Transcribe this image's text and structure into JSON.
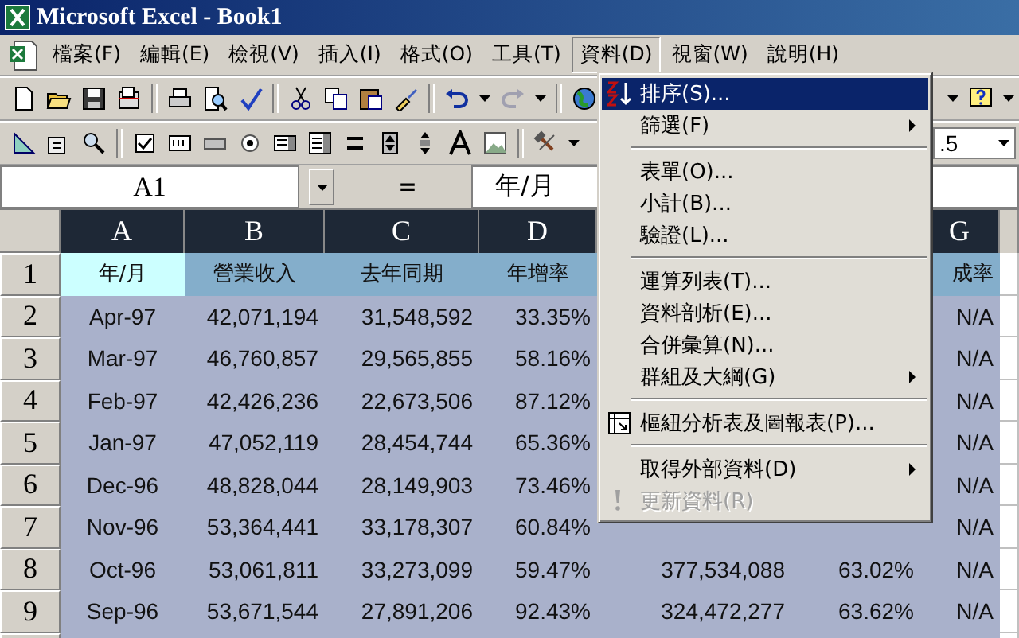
{
  "window": {
    "title": "Microsoft Excel - Book1"
  },
  "menu_bar": [
    {
      "label": "檔案(F)",
      "selected": false
    },
    {
      "label": "編輯(E)",
      "selected": false
    },
    {
      "label": "檢視(V)",
      "selected": false
    },
    {
      "label": "插入(I)",
      "selected": false
    },
    {
      "label": "格式(O)",
      "selected": false
    },
    {
      "label": "工具(T)",
      "selected": false
    },
    {
      "label": "資料(D)",
      "selected": true
    },
    {
      "label": "視窗(W)",
      "selected": false
    },
    {
      "label": "說明(H)",
      "selected": false
    }
  ],
  "toolbar_field": {
    "value": ".5"
  },
  "formula_bar": {
    "name_box": "A1",
    "equals": "=",
    "content": "年/月"
  },
  "sheet": {
    "left_columns": [
      {
        "label": "A",
        "selected": true
      },
      {
        "label": "B",
        "selected": true
      },
      {
        "label": "C",
        "selected": true
      },
      {
        "label": "D",
        "selected": true
      }
    ],
    "right_columns": [
      {
        "label": "G",
        "selected": true
      }
    ],
    "rows": [
      {
        "header": "1",
        "kind": "header",
        "cells": [
          {
            "text": "年/月",
            "selected": true
          },
          {
            "text": "營業收入",
            "selected": false
          },
          {
            "text": "去年同期",
            "selected": false
          },
          {
            "text": "年增率",
            "selected": false
          }
        ],
        "right_cells": [
          {
            "text": "成率",
            "selected": false
          }
        ]
      },
      {
        "header": "2",
        "kind": "data",
        "cells": [
          {
            "text": "Apr-97"
          },
          {
            "text": "42,071,194"
          },
          {
            "text": "31,548,592"
          },
          {
            "text": "33.35%"
          }
        ],
        "right_cells": [
          {
            "text": "N/A"
          }
        ]
      },
      {
        "header": "3",
        "kind": "data",
        "cells": [
          {
            "text": "Mar-97"
          },
          {
            "text": "46,760,857"
          },
          {
            "text": "29,565,855"
          },
          {
            "text": "58.16%"
          }
        ],
        "right_cells": [
          {
            "text": "N/A"
          }
        ]
      },
      {
        "header": "4",
        "kind": "data",
        "cells": [
          {
            "text": "Feb-97"
          },
          {
            "text": "42,426,236"
          },
          {
            "text": "22,673,506"
          },
          {
            "text": "87.12%"
          }
        ],
        "right_cells": [
          {
            "text": "N/A"
          }
        ]
      },
      {
        "header": "5",
        "kind": "data",
        "cells": [
          {
            "text": "Jan-97"
          },
          {
            "text": "47,052,119"
          },
          {
            "text": "28,454,744"
          },
          {
            "text": "65.36%"
          }
        ],
        "right_cells": [
          {
            "text": "N/A"
          }
        ]
      },
      {
        "header": "6",
        "kind": "data",
        "cells": [
          {
            "text": "Dec-96"
          },
          {
            "text": "48,828,044"
          },
          {
            "text": "28,149,903"
          },
          {
            "text": "73.46%"
          }
        ],
        "right_cells": [
          {
            "text": "N/A"
          }
        ]
      },
      {
        "header": "7",
        "kind": "data",
        "cells": [
          {
            "text": "Nov-96"
          },
          {
            "text": "53,364,441"
          },
          {
            "text": "33,178,307"
          },
          {
            "text": "60.84%"
          }
        ],
        "right_cells": [
          {
            "text": "N/A"
          }
        ]
      },
      {
        "header": "8",
        "kind": "data",
        "cells": [
          {
            "text": "Oct-96"
          },
          {
            "text": "53,061,811"
          },
          {
            "text": "33,273,099"
          },
          {
            "text": "59.47%"
          }
        ],
        "right_cells": [
          {
            "text": "377,534,088"
          },
          {
            "text": "63.02%"
          },
          {
            "text": "N/A"
          }
        ]
      },
      {
        "header": "9",
        "kind": "data",
        "cells": [
          {
            "text": "Sep-96"
          },
          {
            "text": "53,671,544"
          },
          {
            "text": "27,891,206"
          },
          {
            "text": "92.43%"
          }
        ],
        "right_cells": [
          {
            "text": "324,472,277"
          },
          {
            "text": "63.62%"
          },
          {
            "text": "N/A"
          }
        ]
      }
    ]
  },
  "menu": {
    "items": [
      {
        "kind": "sort",
        "label": "排序(S)...",
        "selected": true,
        "disabled": false
      },
      {
        "kind": "submenu",
        "label": "篩選(F)",
        "selected": false,
        "disabled": false
      },
      {
        "kind": "separator"
      },
      {
        "kind": "plain",
        "label": "表單(O)...",
        "selected": false,
        "disabled": false
      },
      {
        "kind": "plain",
        "label": "小計(B)...",
        "selected": false,
        "disabled": false
      },
      {
        "kind": "plain",
        "label": "驗證(L)...",
        "selected": false,
        "disabled": false
      },
      {
        "kind": "separator"
      },
      {
        "kind": "plain",
        "label": "運算列表(T)...",
        "selected": false,
        "disabled": false
      },
      {
        "kind": "plain",
        "label": "資料剖析(E)...",
        "selected": false,
        "disabled": false
      },
      {
        "kind": "plain",
        "label": "合併彙算(N)...",
        "selected": false,
        "disabled": false
      },
      {
        "kind": "submenu",
        "label": "群組及大綱(G)",
        "selected": false,
        "disabled": false
      },
      {
        "kind": "separator"
      },
      {
        "kind": "pivot",
        "label": "樞紐分析表及圖報表(P)...",
        "selected": false,
        "disabled": false
      },
      {
        "kind": "separator"
      },
      {
        "kind": "submenu",
        "label": "取得外部資料(D)",
        "selected": false,
        "disabled": false
      },
      {
        "kind": "refresh",
        "label": "更新資料(R)",
        "selected": false,
        "disabled": true
      }
    ]
  }
}
